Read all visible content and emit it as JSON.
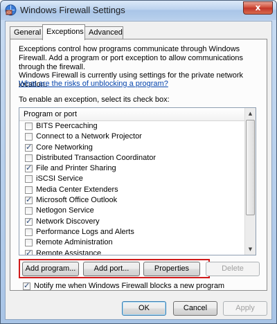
{
  "window": {
    "title": "Windows Firewall Settings",
    "close_glyph": "x",
    "icon": "firewall-icon"
  },
  "tabs": [
    {
      "label": "General",
      "active": false
    },
    {
      "label": "Exceptions",
      "active": true
    },
    {
      "label": "Advanced",
      "active": false
    }
  ],
  "panel": {
    "intro": "Exceptions control how programs communicate through Windows Firewall. Add a program or port exception to allow communications through the firewall.",
    "location_text": "Windows Firewall is currently using settings for the private network location.",
    "risk_link": "What are the risks of unblocking a program?",
    "instruction": "To enable an exception, select its check box:",
    "list_header": "Program or port",
    "items": [
      {
        "label": "BITS Peercaching",
        "checked": false
      },
      {
        "label": "Connect to a Network Projector",
        "checked": false
      },
      {
        "label": "Core Networking",
        "checked": true
      },
      {
        "label": "Distributed Transaction Coordinator",
        "checked": false
      },
      {
        "label": "File and Printer Sharing",
        "checked": true
      },
      {
        "label": "iSCSI Service",
        "checked": false
      },
      {
        "label": "Media Center Extenders",
        "checked": false
      },
      {
        "label": "Microsoft Office Outlook",
        "checked": true
      },
      {
        "label": "Netlogon Service",
        "checked": false
      },
      {
        "label": "Network Discovery",
        "checked": true
      },
      {
        "label": "Performance Logs and Alerts",
        "checked": false
      },
      {
        "label": "Remote Administration",
        "checked": false
      },
      {
        "label": "Remote Assistance",
        "checked": true
      }
    ],
    "buttons": {
      "add_program": "Add program...",
      "add_port": "Add port...",
      "properties": "Properties",
      "delete": "Delete"
    },
    "notify_label": "Notify me when Windows Firewall blocks a new program",
    "notify_checked": true
  },
  "footer": {
    "ok": "OK",
    "cancel": "Cancel",
    "apply": "Apply"
  },
  "colors": {
    "highlight_border": "#d01a1a",
    "link": "#0645ad"
  }
}
